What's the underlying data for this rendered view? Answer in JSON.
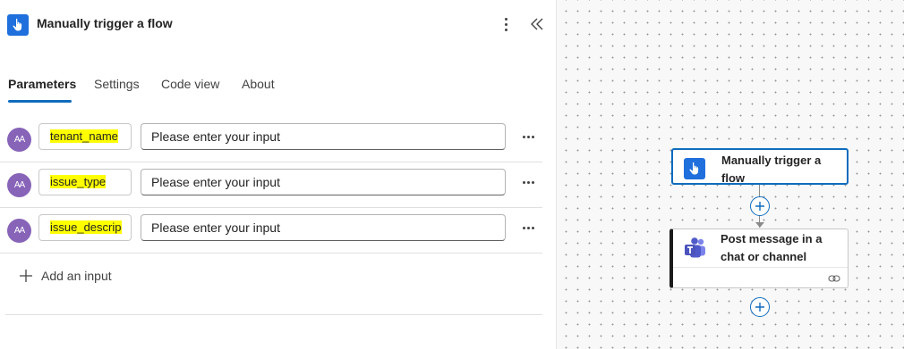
{
  "panel": {
    "title": "Manually trigger a flow",
    "tabs": [
      {
        "label": "Parameters",
        "active": true
      },
      {
        "label": "Settings",
        "active": false
      },
      {
        "label": "Code view",
        "active": false
      },
      {
        "label": "About",
        "active": false
      }
    ],
    "inputs": [
      {
        "avatar": "AA",
        "name": "tenant_name",
        "placeholder": "Please enter your input"
      },
      {
        "avatar": "AA",
        "name": "issue_type",
        "placeholder": "Please enter your input"
      },
      {
        "avatar": "AA",
        "name": "issue_descrip",
        "placeholder": "Please enter your input"
      }
    ],
    "add_input_label": "Add an input"
  },
  "canvas": {
    "trigger_card": {
      "title_line1": "Manually trigger a",
      "title_line2": "flow"
    },
    "action_card": {
      "title_line1": "Post message in a",
      "title_line2": "chat or channel"
    }
  },
  "colors": {
    "accent": "#0f6cbd",
    "trigger_icon_bg": "#1f6fdc",
    "avatar_bg": "#8764b8",
    "highlight": "#ffff00"
  },
  "icons": [
    "touch-trigger-icon",
    "more-vertical-icon",
    "collapse-chevrons-icon",
    "more-horizontal-icon",
    "add-icon",
    "teams-icon",
    "link-icon",
    "plus-circle-icon"
  ]
}
